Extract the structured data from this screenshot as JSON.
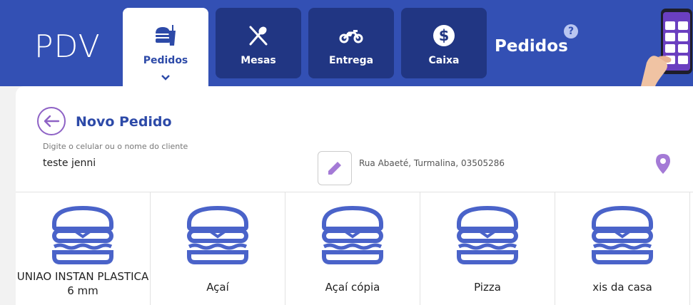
{
  "brand": "PDV",
  "tabs": [
    {
      "label": "Pedidos",
      "icon": "burger-drink-icon",
      "active": true
    },
    {
      "label": "Mesas",
      "icon": "fork-knife-icon",
      "active": false
    },
    {
      "label": "Entrega",
      "icon": "motorcycle-icon",
      "active": false
    },
    {
      "label": "Caixa",
      "icon": "dollar-coin-icon",
      "active": false
    }
  ],
  "header": {
    "title": "Pedidos",
    "help": "?"
  },
  "order": {
    "title": "Novo Pedido",
    "client_label": "Digite o celular ou o nome do cliente",
    "client_value": "teste jenni",
    "address": "Rua Abaeté, Turmalina, 03505286"
  },
  "categories": [
    {
      "label": "UNIAO INSTAN PLASTICA 6 mm",
      "icon": "hamburger-icon"
    },
    {
      "label": "Açaí",
      "icon": "hamburger-icon"
    },
    {
      "label": "Açaí cópia",
      "icon": "hamburger-icon"
    },
    {
      "label": "Pizza",
      "icon": "hamburger-icon"
    },
    {
      "label": "xis da casa",
      "icon": "hamburger-icon"
    }
  ],
  "colors": {
    "primary": "#3350b4",
    "tab_dark": "#213683",
    "accent_purple": "#8e62c5",
    "icon_blue": "#4a63c9"
  }
}
